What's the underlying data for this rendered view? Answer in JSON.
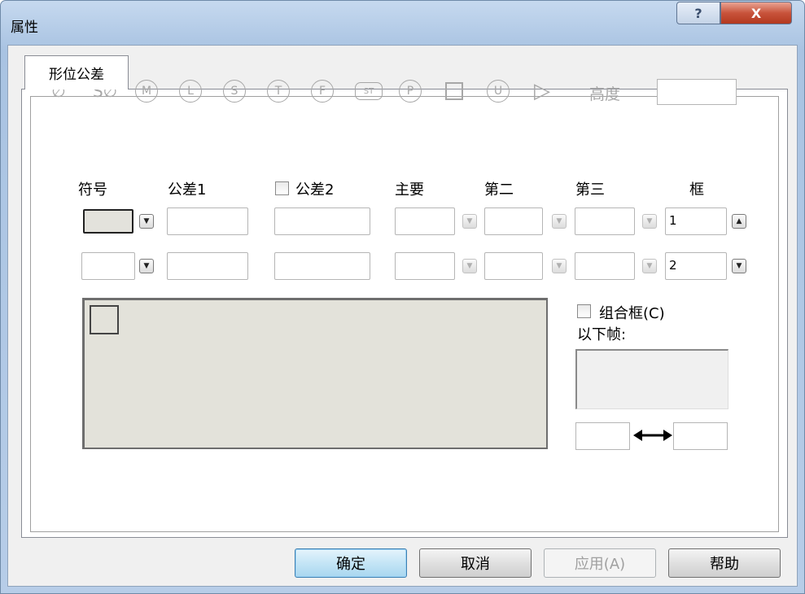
{
  "window": {
    "title": "属性",
    "help_glyph": "?",
    "close_glyph": "X"
  },
  "tab": {
    "label": "形位公差"
  },
  "symbols": [
    {
      "name": "diameter",
      "glyph": "∅"
    },
    {
      "name": "spherical-diameter",
      "glyph": "S∅"
    },
    {
      "name": "max-material",
      "glyph": "M"
    },
    {
      "name": "least-material",
      "glyph": "L"
    },
    {
      "name": "regardless-feature-size",
      "glyph": "S"
    },
    {
      "name": "tangent-plane",
      "glyph": "T"
    },
    {
      "name": "free-state",
      "glyph": "F"
    },
    {
      "name": "statistical",
      "glyph": "ST"
    },
    {
      "name": "projected-zone",
      "glyph": "P"
    },
    {
      "name": "square",
      "glyph": ""
    },
    {
      "name": "unequal-bilateral",
      "glyph": "U"
    },
    {
      "name": "triangle",
      "glyph": "▷"
    }
  ],
  "height": {
    "label": "高度",
    "value": ""
  },
  "columns": {
    "symbol": "符号",
    "tolerance1": "公差1",
    "tolerance2": "公差2",
    "primary": "主要",
    "secondary": "第二",
    "tertiary": "第三",
    "frame": "框"
  },
  "rows": [
    {
      "frame": "1"
    },
    {
      "frame": "2"
    }
  ],
  "group": {
    "checkbox_label": "组合框(C)",
    "frames_below_label": "以下帧:"
  },
  "buttons": {
    "ok": "确定",
    "cancel": "取消",
    "apply": "应用(A)",
    "help": "帮助"
  }
}
